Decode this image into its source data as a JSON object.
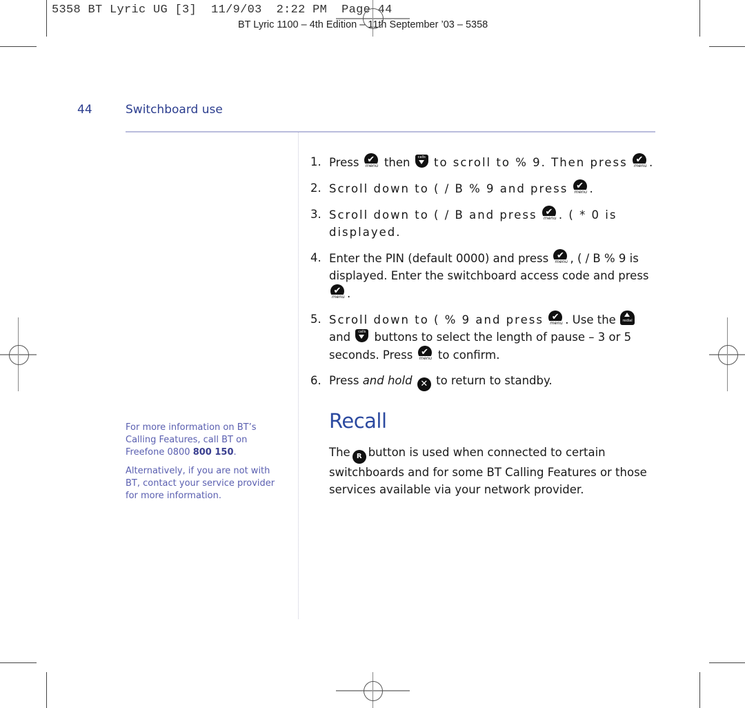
{
  "slug_line": {
    "job": "5358 BT Lyric UG [3]",
    "date": "11/9/03",
    "time": "2:22 PM",
    "page": "Page 44"
  },
  "edition_line": "BT Lyric 1100 – 4th Edition – 11th September ’03 – 5358",
  "header": {
    "page_number": "44",
    "section_title": "Switchboard use"
  },
  "icons": {
    "menu_sub": "menu",
    "menu_glyph": "✔",
    "calls_label": "calls",
    "redial_label": "redial",
    "end_glyph": "✕",
    "recall_glyph": "R"
  },
  "steps": [
    {
      "num": "1.",
      "parts": [
        "Press",
        "then",
        "to scroll to %    9. Then press",
        "."
      ]
    },
    {
      "num": "2.",
      "parts": [
        "Scroll down to ( /   B  %    9 and press",
        "."
      ]
    },
    {
      "num": "3.",
      "parts": [
        "Scroll down to ( /   B     and press",
        ".  (  *          0  is displayed."
      ]
    },
    {
      "num": "4.",
      "parts": [
        "Enter the PIN (default 0000) and press",
        ", ( /   B  %    9 is displayed. Enter the switchboard access code and press",
        "."
      ]
    },
    {
      "num": "5.",
      "parts": [
        "Scroll down to (             %    9 and press",
        ". Use the",
        "and",
        "buttons to select the length of pause – 3 or 5 seconds. Press",
        "to confirm."
      ]
    },
    {
      "num": "6.",
      "parts": [
        "Press",
        "and hold",
        "to return to standby."
      ]
    }
  ],
  "sidenote": {
    "para1_text": "For more information on BT’s Calling Features, call BT on Freefone 0800 ",
    "para1_bold": "800 150",
    "para1_end": ".",
    "para2": "Alternatively, if you are not with BT, contact your service provider for more information."
  },
  "recall": {
    "title": "Recall",
    "body_start": "The",
    "body_rest": "button is used when connected to certain switchboards and for some BT Calling Features or those services available via your network provider."
  },
  "colors": {
    "heading_blue": "#2c3e8f",
    "recall_blue": "#2c4aa0",
    "sidenote_blue": "#5a5fb0",
    "rule_lavender": "#b9bcdc"
  }
}
